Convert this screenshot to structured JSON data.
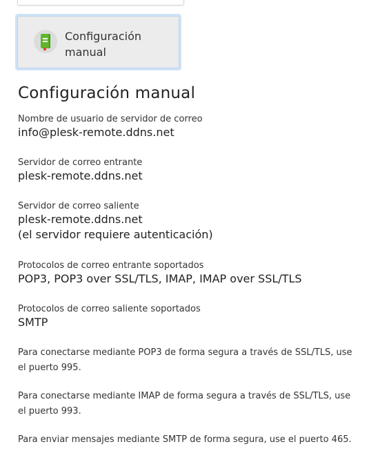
{
  "option": {
    "icon": "manual-book-icon",
    "label_line1": "Configuración",
    "label_line2": "manual"
  },
  "section_title": "Configuración manual",
  "fields": [
    {
      "label": "Nombre de usuario de servidor de correo",
      "value": "info@plesk-remote.ddns.net"
    },
    {
      "label": "Servidor de correo entrante",
      "value": "plesk-remote.ddns.net"
    },
    {
      "label": "Servidor de correo saliente",
      "value": "plesk-remote.ddns.net",
      "value2": "(el servidor requiere autenticación)"
    },
    {
      "label": "Protocolos de correo entrante soportados",
      "value": "POP3, POP3 over SSL/TLS, IMAP, IMAP over SSL/TLS"
    },
    {
      "label": "Protocolos de correo saliente soportados",
      "value": "SMTP"
    }
  ],
  "notes": [
    "Para conectarse mediante POP3 de forma segura a través de SSL/TLS, use el puerto 995.",
    "Para conectarse mediante IMAP de forma segura a través de SSL/TLS, use el puerto 993.",
    "Para enviar mensajes mediante SMTP de forma segura, use el puerto 465."
  ],
  "colors": {
    "card_bg": "#ececec",
    "card_border": "#cfe3f7",
    "book_green": "#5fb62c"
  }
}
